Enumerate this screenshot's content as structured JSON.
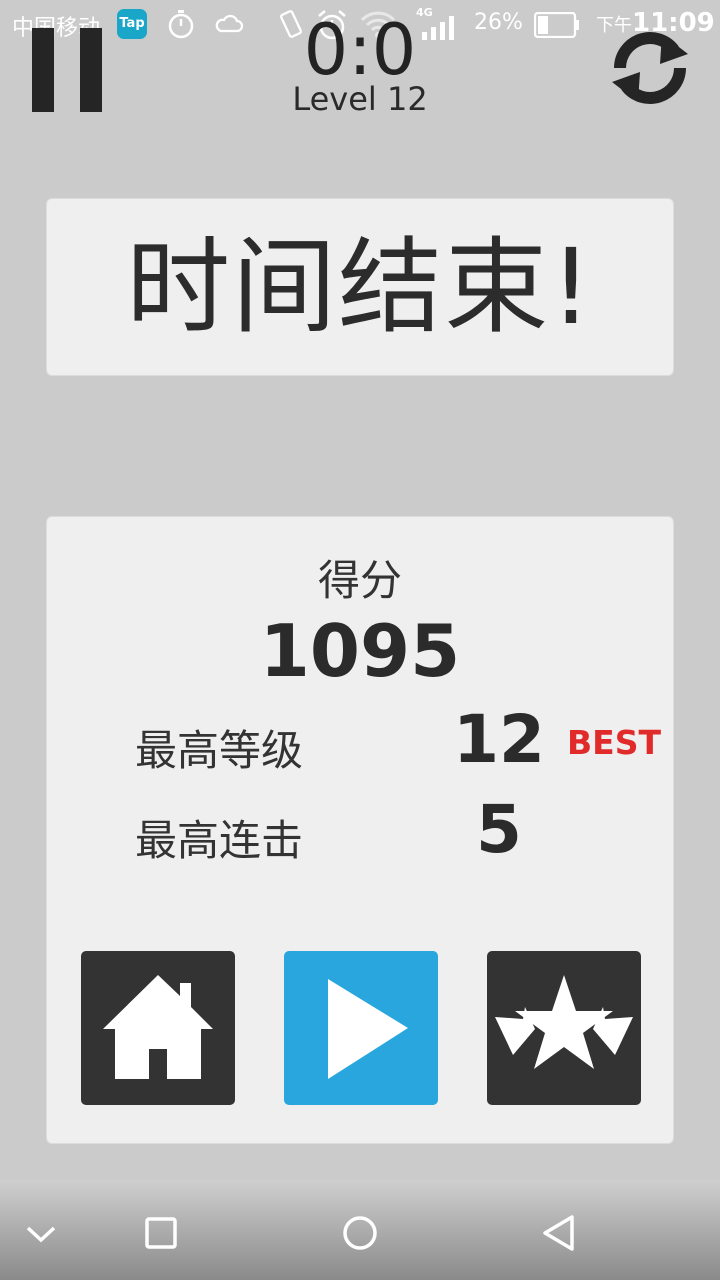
{
  "status_bar": {
    "carrier": "中国移动",
    "app_badge": "Tap",
    "network": "4G",
    "battery": "26%",
    "time_prefix": "下午",
    "time": "11:09"
  },
  "header": {
    "timer": "0:0",
    "level": "Level 12"
  },
  "result": {
    "title": "时间结束!",
    "score_label": "得分",
    "score_value": "1095",
    "stats": [
      {
        "label": "最高等级",
        "value": "12",
        "badge": "BEST"
      },
      {
        "label": "最高连击",
        "value": "5"
      }
    ]
  },
  "buttons": {
    "home_icon": "home-icon",
    "play_icon": "play-icon",
    "rate_icon": "stars-icon"
  },
  "colors": {
    "background": "#cbcbcb",
    "panel": "#efefef",
    "play_button": "#29a6de",
    "dark_button": "#333333",
    "best_badge": "#e12a2a"
  }
}
